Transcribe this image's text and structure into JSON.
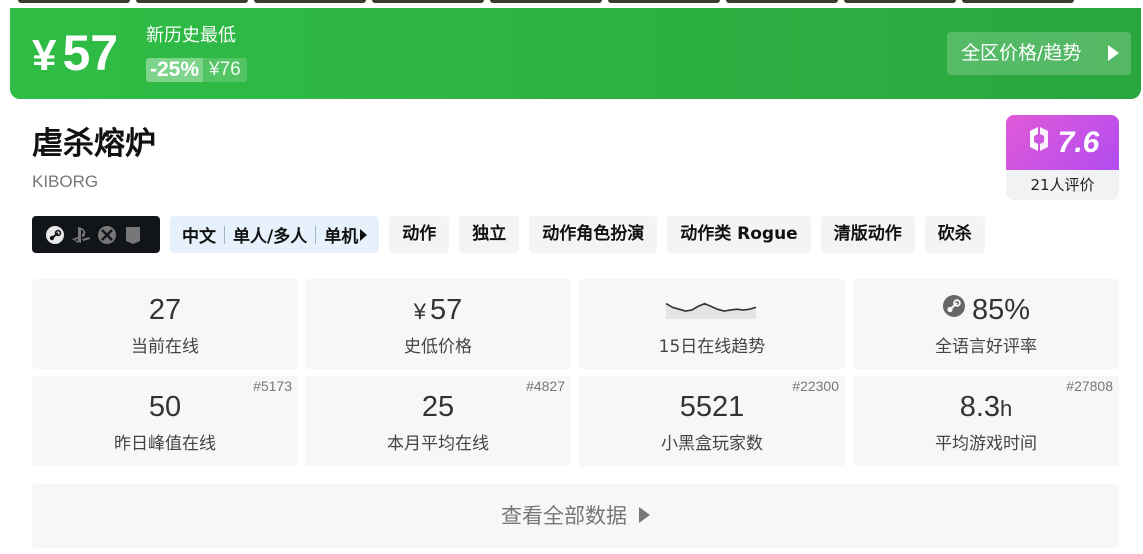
{
  "banner": {
    "currency": "¥",
    "price": "57",
    "label": "新历史最低",
    "discount": "-25%",
    "original_price": "¥76",
    "region_button": "全区价格/趋势"
  },
  "game": {
    "title": "虐杀熔炉",
    "subtitle": "KIBORG"
  },
  "score": {
    "value": "7.6",
    "reviews": "21人评价"
  },
  "platforms": [
    "steam-icon",
    "playstation-icon",
    "xbox-icon",
    "store-icon"
  ],
  "lang_tag": {
    "language": "中文",
    "mode": "单人/多人",
    "type": "单机"
  },
  "tags": [
    "动作",
    "独立",
    "动作角色扮演",
    "动作类 Rogue",
    "清版动作",
    "砍杀"
  ],
  "stats": {
    "current_online": {
      "value": "27",
      "label": "当前在线"
    },
    "lowest_price": {
      "currency": "¥",
      "value": "57",
      "label": "史低价格"
    },
    "trend": {
      "label": "15日在线趋势",
      "points": [
        14,
        18,
        20,
        22,
        21,
        17,
        14,
        17,
        20,
        22,
        21,
        20,
        21,
        20,
        18
      ]
    },
    "positive_rate": {
      "value": "85%",
      "label": "全语言好评率"
    },
    "yesterday_peak": {
      "value": "50",
      "label": "昨日峰值在线",
      "rank": "#5173"
    },
    "month_avg": {
      "value": "25",
      "label": "本月平均在线",
      "rank": "#4827"
    },
    "players": {
      "value": "5521",
      "label": "小黑盒玩家数",
      "rank": "#22300"
    },
    "avg_playtime": {
      "value": "8.3",
      "unit": "h",
      "label": "平均游戏时间",
      "rank": "#27808"
    }
  },
  "all_data_button": "查看全部数据",
  "colors": {
    "banner_green": "#2db042",
    "score_pink": "#e05ad7",
    "score_purple": "#b24cf0"
  }
}
